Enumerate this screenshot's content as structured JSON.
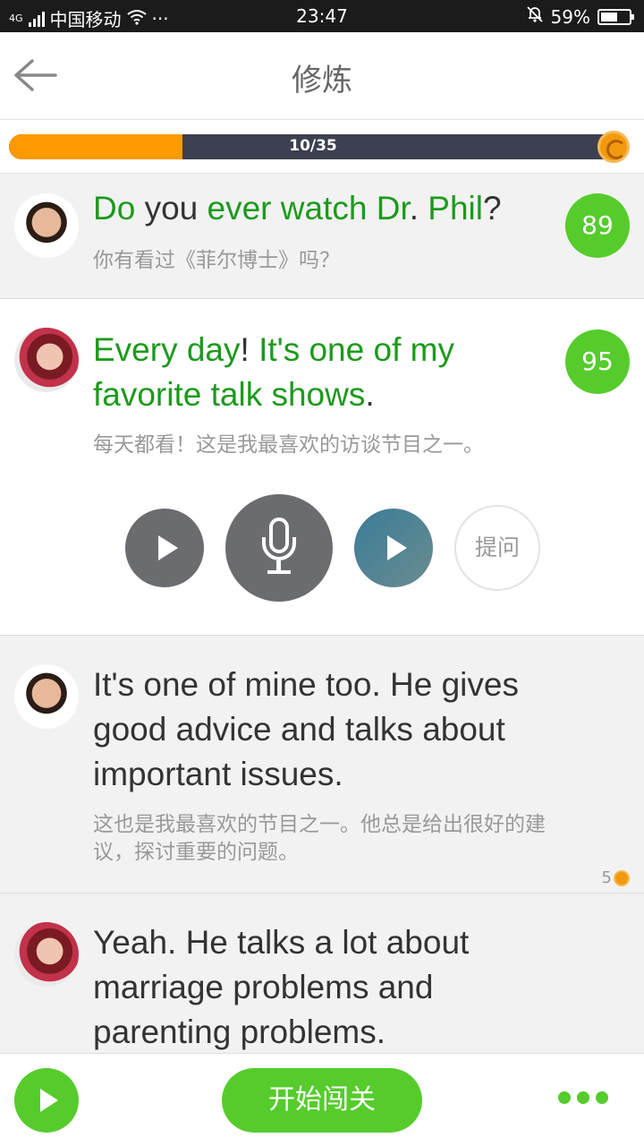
{
  "statusbar": {
    "network": "4G",
    "carrier": "中国移动",
    "dots": "···",
    "time": "23:47",
    "battery": "59%",
    "battery_level": 0.59
  },
  "header": {
    "title": "修炼",
    "back_icon": "back-arrow-icon"
  },
  "progress": {
    "label": "10/35",
    "current": 10,
    "total": 35,
    "color": "#ff9900"
  },
  "messages": [
    {
      "en_parts": [
        {
          "text": "Do",
          "green": true
        },
        {
          "text": " you ",
          "green": false
        },
        {
          "text": "ever watch Dr",
          "green": true
        },
        {
          "text": ". ",
          "green": false
        },
        {
          "text": "Phil",
          "green": true
        },
        {
          "text": "?",
          "green": false
        }
      ],
      "zh": "你有看过《菲尔博士》吗？",
      "score": "89"
    },
    {
      "en_parts": [
        {
          "text": "Every day",
          "green": true
        },
        {
          "text": "! ",
          "green": false
        },
        {
          "text": "It's one of my favorite talk shows",
          "green": true
        },
        {
          "text": ".",
          "green": false
        }
      ],
      "zh": "每天都看！这是我最喜欢的访谈节目之一。",
      "score": "95"
    },
    {
      "en": "It's one of mine too. He gives good advice and talks about important issues.",
      "zh": "这也是我最喜欢的节目之一。他总是给出很好的建议，探讨重要的问题。",
      "coins": "5"
    },
    {
      "en": "Yeah. He talks a lot about marriage problems and parenting problems."
    }
  ],
  "controls": {
    "ask_label": "提问"
  },
  "bottom": {
    "start_label": "开始闯关"
  },
  "colors": {
    "green": "#55cc2c",
    "text_green": "#1c9a1c",
    "orange": "#ff9900"
  }
}
